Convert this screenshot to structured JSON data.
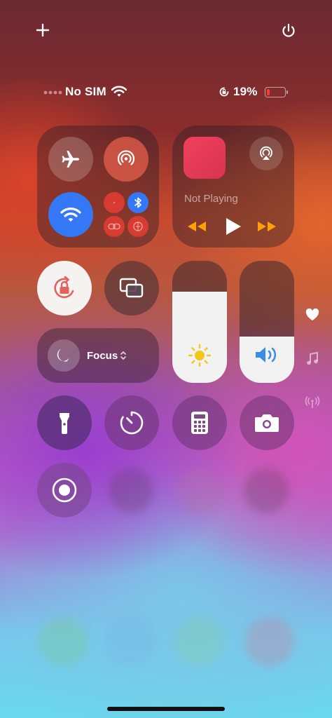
{
  "status_bar": {
    "carrier": "No SIM",
    "battery_percent": "19%",
    "battery_level": 0.19
  },
  "media": {
    "now_playing": "Not Playing"
  },
  "focus": {
    "label": "Focus"
  },
  "sliders": {
    "brightness_level": 0.75,
    "volume_level": 0.38
  },
  "colors": {
    "wifi_active": "#3478f6",
    "bluetooth_active": "#3478f6",
    "media_controls": "#ff9f0a",
    "battery_low": "#ff3b30"
  }
}
